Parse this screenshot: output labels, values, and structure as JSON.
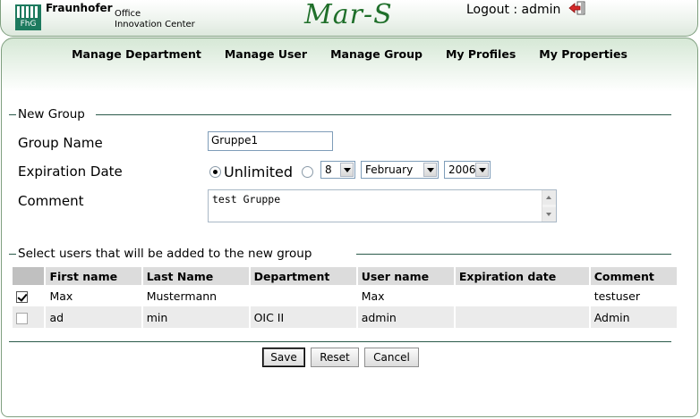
{
  "brand": {
    "logo_text": "FhG",
    "name": "Fraunhofer",
    "sub_line1": "Office",
    "sub_line2": "Innovation Center"
  },
  "app_title": "Mar-S",
  "logout": {
    "label": "Logout : admin",
    "icon": "logout-arrow-icon"
  },
  "nav": [
    "Manage Department",
    "Manage User",
    "Manage Group",
    "My Profiles",
    "My Properties"
  ],
  "new_group": {
    "legend": "New Group",
    "group_name": {
      "label": "Group Name",
      "value": "Gruppe1"
    },
    "expiration": {
      "label": "Expiration Date",
      "unlimited_label": "Unlimited",
      "unlimited_selected": true,
      "day": "8",
      "month": "February",
      "year": "2006"
    },
    "comment": {
      "label": "Comment",
      "value": "test Gruppe"
    }
  },
  "select_users": {
    "legend": "Select users that will be added to the new group",
    "columns": [
      "First name",
      "Last Name",
      "Department",
      "User name",
      "Expiration date",
      "Comment"
    ],
    "rows": [
      {
        "checked": true,
        "first_name": "Max",
        "last_name": "Mustermann",
        "department": "",
        "user_name": "Max",
        "expiration": "",
        "comment": "testuser"
      },
      {
        "checked": false,
        "first_name": "ad",
        "last_name": "min",
        "department": "OIC II",
        "user_name": "admin",
        "expiration": "",
        "comment": "Admin"
      }
    ]
  },
  "buttons": {
    "save": "Save",
    "reset": "Reset",
    "cancel": "Cancel"
  },
  "colors": {
    "title_green": "#1f6f2a",
    "line_green": "#2b5a4a",
    "logo_green": "#1d7a5e"
  }
}
